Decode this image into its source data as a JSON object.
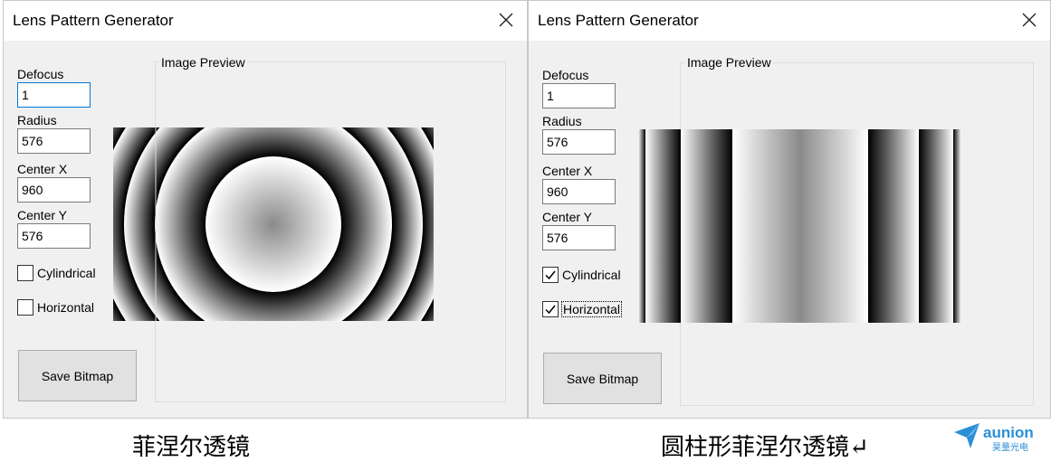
{
  "left_window": {
    "title": "Lens Pattern Generator",
    "defocus_label": "Defocus",
    "defocus_value": "1",
    "radius_label": "Radius",
    "radius_value": "576",
    "center_x_label": "Center X",
    "center_x_value": "960",
    "center_y_label": "Center Y",
    "center_y_value": "576",
    "cylindrical_label": "Cylindrical",
    "cylindrical_checked": false,
    "horizontal_label": "Horizontal",
    "horizontal_checked": false,
    "save_label": "Save Bitmap",
    "preview_title": "Image Preview"
  },
  "right_window": {
    "title": "Lens Pattern Generator",
    "defocus_label": "Defocus",
    "defocus_value": "1",
    "radius_label": "Radius",
    "radius_value": "576",
    "center_x_label": "Center X",
    "center_x_value": "960",
    "center_y_label": "Center Y",
    "center_y_value": "576",
    "cylindrical_label": "Cylindrical",
    "cylindrical_checked": true,
    "horizontal_label": "Horizontal",
    "horizontal_checked": true,
    "save_label": "Save Bitmap",
    "preview_title": "Image Preview"
  },
  "captions": {
    "left": "菲涅尔透镜",
    "right": "圆柱形菲涅尔透镜↵"
  },
  "logo": {
    "name": "aunion",
    "subtitle": "昊量光电",
    "color": "#2a8fd6"
  },
  "icons": {
    "close": "close-icon",
    "check": "checkmark-icon"
  }
}
